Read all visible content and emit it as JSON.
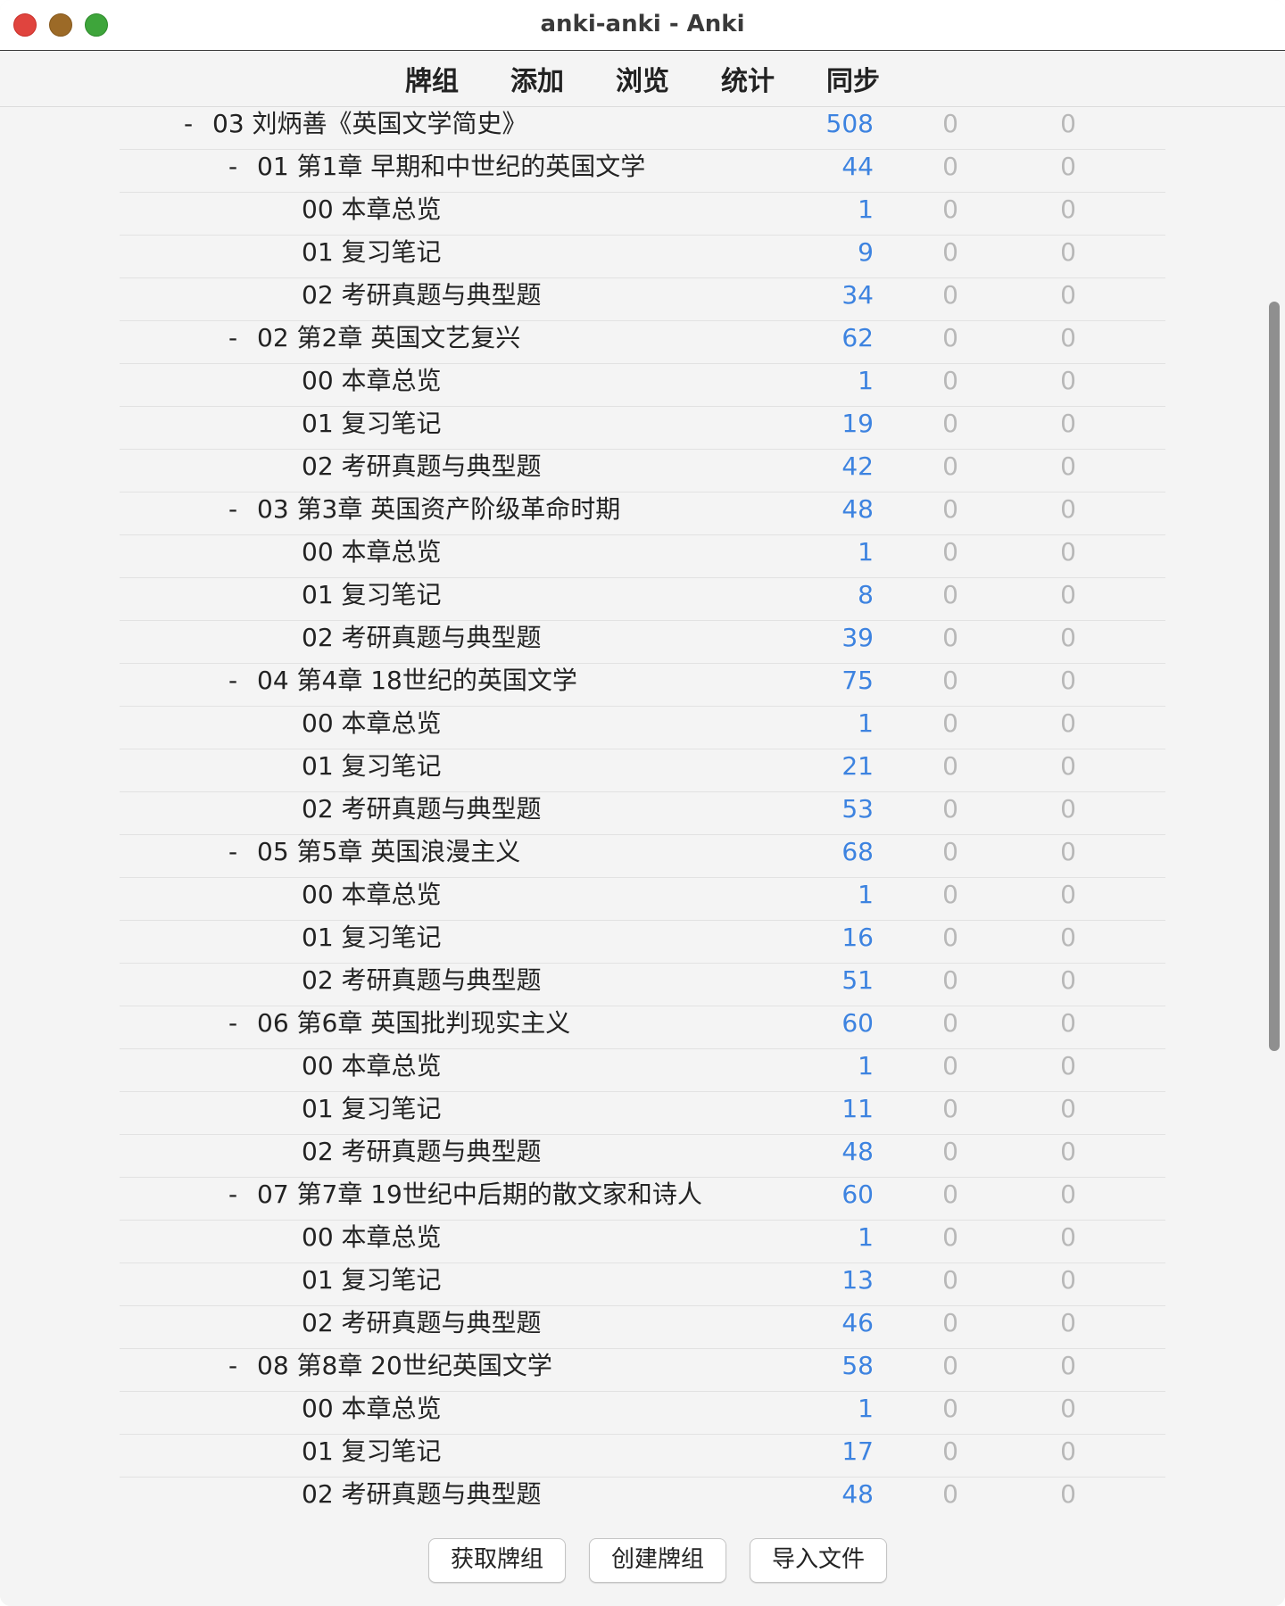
{
  "window": {
    "title": "anki-anki - Anki"
  },
  "toolbar": {
    "items": [
      "牌组",
      "添加",
      "浏览",
      "统计",
      "同步"
    ]
  },
  "decks": [
    {
      "level": 0,
      "collapse": "-",
      "name": "03 刘炳善《英国文学简史》",
      "new": "508",
      "learn": "0",
      "due": "0"
    },
    {
      "level": 1,
      "collapse": "-",
      "name": "01 第1章 早期和中世纪的英国文学",
      "new": "44",
      "learn": "0",
      "due": "0"
    },
    {
      "level": 2,
      "collapse": "",
      "name": "00 本章总览",
      "new": "1",
      "learn": "0",
      "due": "0"
    },
    {
      "level": 2,
      "collapse": "",
      "name": "01 复习笔记",
      "new": "9",
      "learn": "0",
      "due": "0"
    },
    {
      "level": 2,
      "collapse": "",
      "name": "02 考研真题与典型题",
      "new": "34",
      "learn": "0",
      "due": "0"
    },
    {
      "level": 1,
      "collapse": "-",
      "name": "02 第2章 英国文艺复兴",
      "new": "62",
      "learn": "0",
      "due": "0"
    },
    {
      "level": 2,
      "collapse": "",
      "name": "00 本章总览",
      "new": "1",
      "learn": "0",
      "due": "0"
    },
    {
      "level": 2,
      "collapse": "",
      "name": "01 复习笔记",
      "new": "19",
      "learn": "0",
      "due": "0"
    },
    {
      "level": 2,
      "collapse": "",
      "name": "02 考研真题与典型题",
      "new": "42",
      "learn": "0",
      "due": "0"
    },
    {
      "level": 1,
      "collapse": "-",
      "name": "03 第3章 英国资产阶级革命时期",
      "new": "48",
      "learn": "0",
      "due": "0"
    },
    {
      "level": 2,
      "collapse": "",
      "name": "00 本章总览",
      "new": "1",
      "learn": "0",
      "due": "0"
    },
    {
      "level": 2,
      "collapse": "",
      "name": "01 复习笔记",
      "new": "8",
      "learn": "0",
      "due": "0"
    },
    {
      "level": 2,
      "collapse": "",
      "name": "02 考研真题与典型题",
      "new": "39",
      "learn": "0",
      "due": "0"
    },
    {
      "level": 1,
      "collapse": "-",
      "name": "04 第4章 18世纪的英国文学",
      "new": "75",
      "learn": "0",
      "due": "0"
    },
    {
      "level": 2,
      "collapse": "",
      "name": "00 本章总览",
      "new": "1",
      "learn": "0",
      "due": "0"
    },
    {
      "level": 2,
      "collapse": "",
      "name": "01 复习笔记",
      "new": "21",
      "learn": "0",
      "due": "0"
    },
    {
      "level": 2,
      "collapse": "",
      "name": "02 考研真题与典型题",
      "new": "53",
      "learn": "0",
      "due": "0"
    },
    {
      "level": 1,
      "collapse": "-",
      "name": "05 第5章 英国浪漫主义",
      "new": "68",
      "learn": "0",
      "due": "0"
    },
    {
      "level": 2,
      "collapse": "",
      "name": "00 本章总览",
      "new": "1",
      "learn": "0",
      "due": "0"
    },
    {
      "level": 2,
      "collapse": "",
      "name": "01 复习笔记",
      "new": "16",
      "learn": "0",
      "due": "0"
    },
    {
      "level": 2,
      "collapse": "",
      "name": "02 考研真题与典型题",
      "new": "51",
      "learn": "0",
      "due": "0"
    },
    {
      "level": 1,
      "collapse": "-",
      "name": "06 第6章 英国批判现实主义",
      "new": "60",
      "learn": "0",
      "due": "0"
    },
    {
      "level": 2,
      "collapse": "",
      "name": "00 本章总览",
      "new": "1",
      "learn": "0",
      "due": "0"
    },
    {
      "level": 2,
      "collapse": "",
      "name": "01 复习笔记",
      "new": "11",
      "learn": "0",
      "due": "0"
    },
    {
      "level": 2,
      "collapse": "",
      "name": "02 考研真题与典型题",
      "new": "48",
      "learn": "0",
      "due": "0"
    },
    {
      "level": 1,
      "collapse": "-",
      "name": "07 第7章 19世纪中后期的散文家和诗人",
      "new": "60",
      "learn": "0",
      "due": "0"
    },
    {
      "level": 2,
      "collapse": "",
      "name": "00 本章总览",
      "new": "1",
      "learn": "0",
      "due": "0"
    },
    {
      "level": 2,
      "collapse": "",
      "name": "01 复习笔记",
      "new": "13",
      "learn": "0",
      "due": "0"
    },
    {
      "level": 2,
      "collapse": "",
      "name": "02 考研真题与典型题",
      "new": "46",
      "learn": "0",
      "due": "0"
    },
    {
      "level": 1,
      "collapse": "-",
      "name": "08 第8章 20世纪英国文学",
      "new": "58",
      "learn": "0",
      "due": "0"
    },
    {
      "level": 2,
      "collapse": "",
      "name": "00 本章总览",
      "new": "1",
      "learn": "0",
      "due": "0"
    },
    {
      "level": 2,
      "collapse": "",
      "name": "01 复习笔记",
      "new": "17",
      "learn": "0",
      "due": "0"
    },
    {
      "level": 2,
      "collapse": "",
      "name": "02 考研真题与典型题",
      "new": "48",
      "learn": "0",
      "due": "0"
    }
  ],
  "colors": {
    "new_count": "#3d83e0",
    "zero_count": "#b8b8b8",
    "close": "#e0443e",
    "minimize": "#9c6a27",
    "maximize": "#3ea53b"
  },
  "bottom": {
    "buttons": [
      "获取牌组",
      "创建牌组",
      "导入文件"
    ]
  }
}
